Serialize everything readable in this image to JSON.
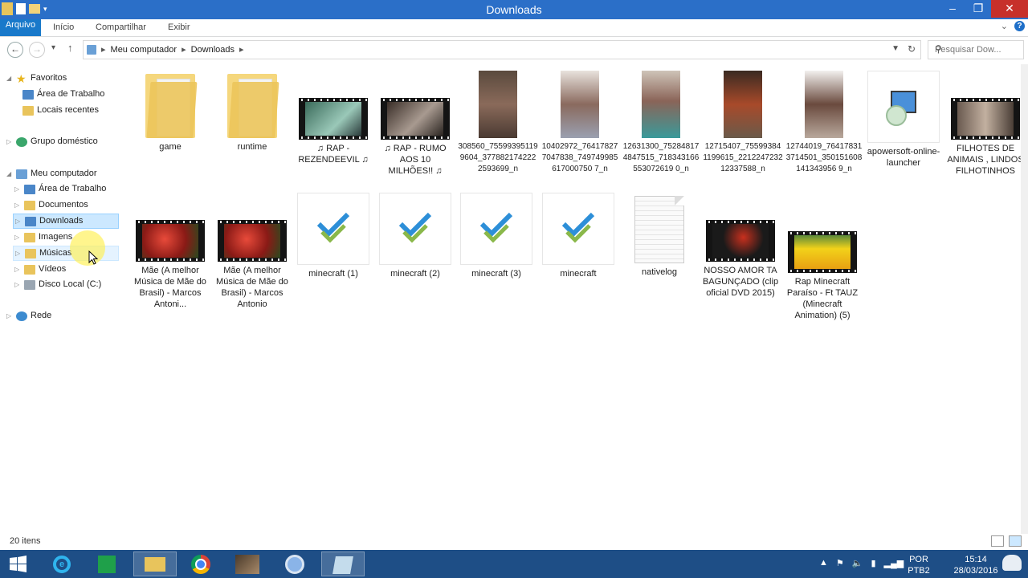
{
  "window": {
    "title": "Downloads"
  },
  "ribbon": {
    "tabs": [
      "Arquivo",
      "Início",
      "Compartilhar",
      "Exibir"
    ],
    "help": "?"
  },
  "address": {
    "crumbs": [
      "Meu computador",
      "Downloads"
    ],
    "search_placeholder": "Pesquisar Dow..."
  },
  "navpane": {
    "items": [
      {
        "label": "Favoritos",
        "level": 0,
        "icon": "star-icon"
      },
      {
        "label": "Área de Trabalho",
        "level": 1,
        "icon": "desktop-icon"
      },
      {
        "label": "Locais recentes",
        "level": 1,
        "icon": "recent-icon"
      },
      {
        "label": "Grupo doméstico",
        "level": 0,
        "icon": "homegroup-icon"
      },
      {
        "label": "Meu computador",
        "level": 0,
        "icon": "computer-icon"
      },
      {
        "label": "Área de Trabalho",
        "level": 1,
        "icon": "desktop-icon"
      },
      {
        "label": "Documentos",
        "level": 1,
        "icon": "documents-icon"
      },
      {
        "label": "Downloads",
        "level": 1,
        "icon": "downloads-icon",
        "selected": true
      },
      {
        "label": "Imagens",
        "level": 1,
        "icon": "pictures-icon"
      },
      {
        "label": "Músicas",
        "level": 1,
        "icon": "music-icon",
        "hover": true
      },
      {
        "label": "Vídeos",
        "level": 1,
        "icon": "videos-icon"
      },
      {
        "label": "Disco Local (C:)",
        "level": 1,
        "icon": "disk-icon"
      },
      {
        "label": "Rede",
        "level": 0,
        "icon": "network-icon"
      }
    ]
  },
  "files": [
    {
      "label": "game",
      "kind": "folder"
    },
    {
      "label": "runtime",
      "kind": "folder"
    },
    {
      "label": "♫ RAP  - REZENDEEVIL ♫",
      "kind": "video",
      "tint": "#5f9a8a"
    },
    {
      "label": "♫ RAP  - RUMO AOS 10 MILHÕES!! ♫",
      "kind": "video",
      "tint": "#7d6a5c"
    },
    {
      "label": "308560_755993951199604_3778821742222593699_n",
      "kind": "photo",
      "tint": "#6b5a4c"
    },
    {
      "label": "10402972_764178277047838_749749985617000750 7_n",
      "kind": "photo",
      "tint": "#b8a8a0"
    },
    {
      "label": "12631300_752848174847515_718343166553072619 0_n",
      "kind": "photo",
      "tint": "#6f8a8a"
    },
    {
      "label": "12715407_755993841199615_221224723212337588_n",
      "kind": "photo",
      "tint": "#8a4a3a"
    },
    {
      "label": "12744019_764178313714501_350151608141343956 9_n",
      "kind": "photo",
      "tint": "#c4b4a8"
    },
    {
      "label": "apowersoft-online-launcher",
      "kind": "exe"
    },
    {
      "label": "FILHOTES DE ANIMAIS , LINDOS FILHOTINHOS",
      "kind": "video",
      "tint": "#7a6a5e"
    },
    {
      "label": "Mãe (A melhor Música de Mãe do Brasil) - Marcos Antoni...",
      "kind": "video",
      "tint": "#b53a32"
    },
    {
      "label": "Mãe (A melhor Música de Mãe do Brasil) - Marcos Antonio",
      "kind": "video",
      "tint": "#b53a32"
    },
    {
      "label": "minecraft (1)",
      "kind": "check"
    },
    {
      "label": "minecraft (2)",
      "kind": "check"
    },
    {
      "label": "minecraft (3)",
      "kind": "check"
    },
    {
      "label": "minecraft",
      "kind": "check"
    },
    {
      "label": "nativelog",
      "kind": "doc"
    },
    {
      "label": "NOSSO AMOR TA BAGUNÇADO (clip oficial DVD 2015)",
      "kind": "video",
      "tint": "#2a2a2a"
    },
    {
      "label": "Rap Minecraft Paraíso - Ft TAUZ (Minecraft Animation) (5)",
      "kind": "video",
      "tint": "#e8c21a"
    }
  ],
  "status": {
    "count": "20 itens"
  },
  "taskbar": {
    "apps": [
      "start-icon",
      "ie-icon",
      "store-icon",
      "explorer-icon",
      "chrome-icon",
      "video-app-icon",
      "chrome-canary-icon",
      "notes-icon"
    ],
    "lang": [
      "POR",
      "PTB2"
    ],
    "time": "15:14",
    "date": "28/03/2016"
  }
}
